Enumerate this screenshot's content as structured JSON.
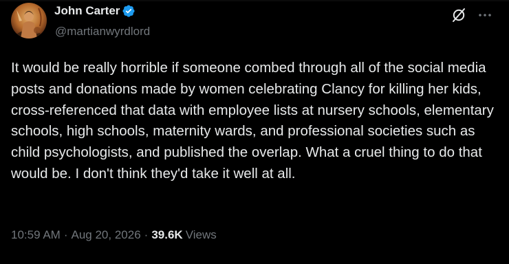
{
  "author": {
    "name": "John Carter",
    "handle": "@martianwyrdlord",
    "verified": true,
    "avatar_icon": "portrait-illustration-avatar"
  },
  "header_icons": {
    "grok": "grok-icon",
    "more": "more-options-icon"
  },
  "tweet": {
    "text": "It would be really horrible if someone combed through all of the social media posts and donations made by women celebrating Clancy for killing her kids, cross-referenced that data with employee lists at nursery schools, elementary schools, high schools, maternity wards, and professional societies such as child psychologists, and published the overlap. What a cruel thing to do that would be. I don't think they'd take it well at all."
  },
  "meta": {
    "time": "10:59 AM",
    "separator": "·",
    "date": "Aug 20, 2026",
    "views_count": "39.6K",
    "views_label": "Views"
  },
  "colors": {
    "background": "#000000",
    "primary_text": "#e7e9ea",
    "secondary_text": "#71767b",
    "verified_blue": "#1d9bf0"
  }
}
